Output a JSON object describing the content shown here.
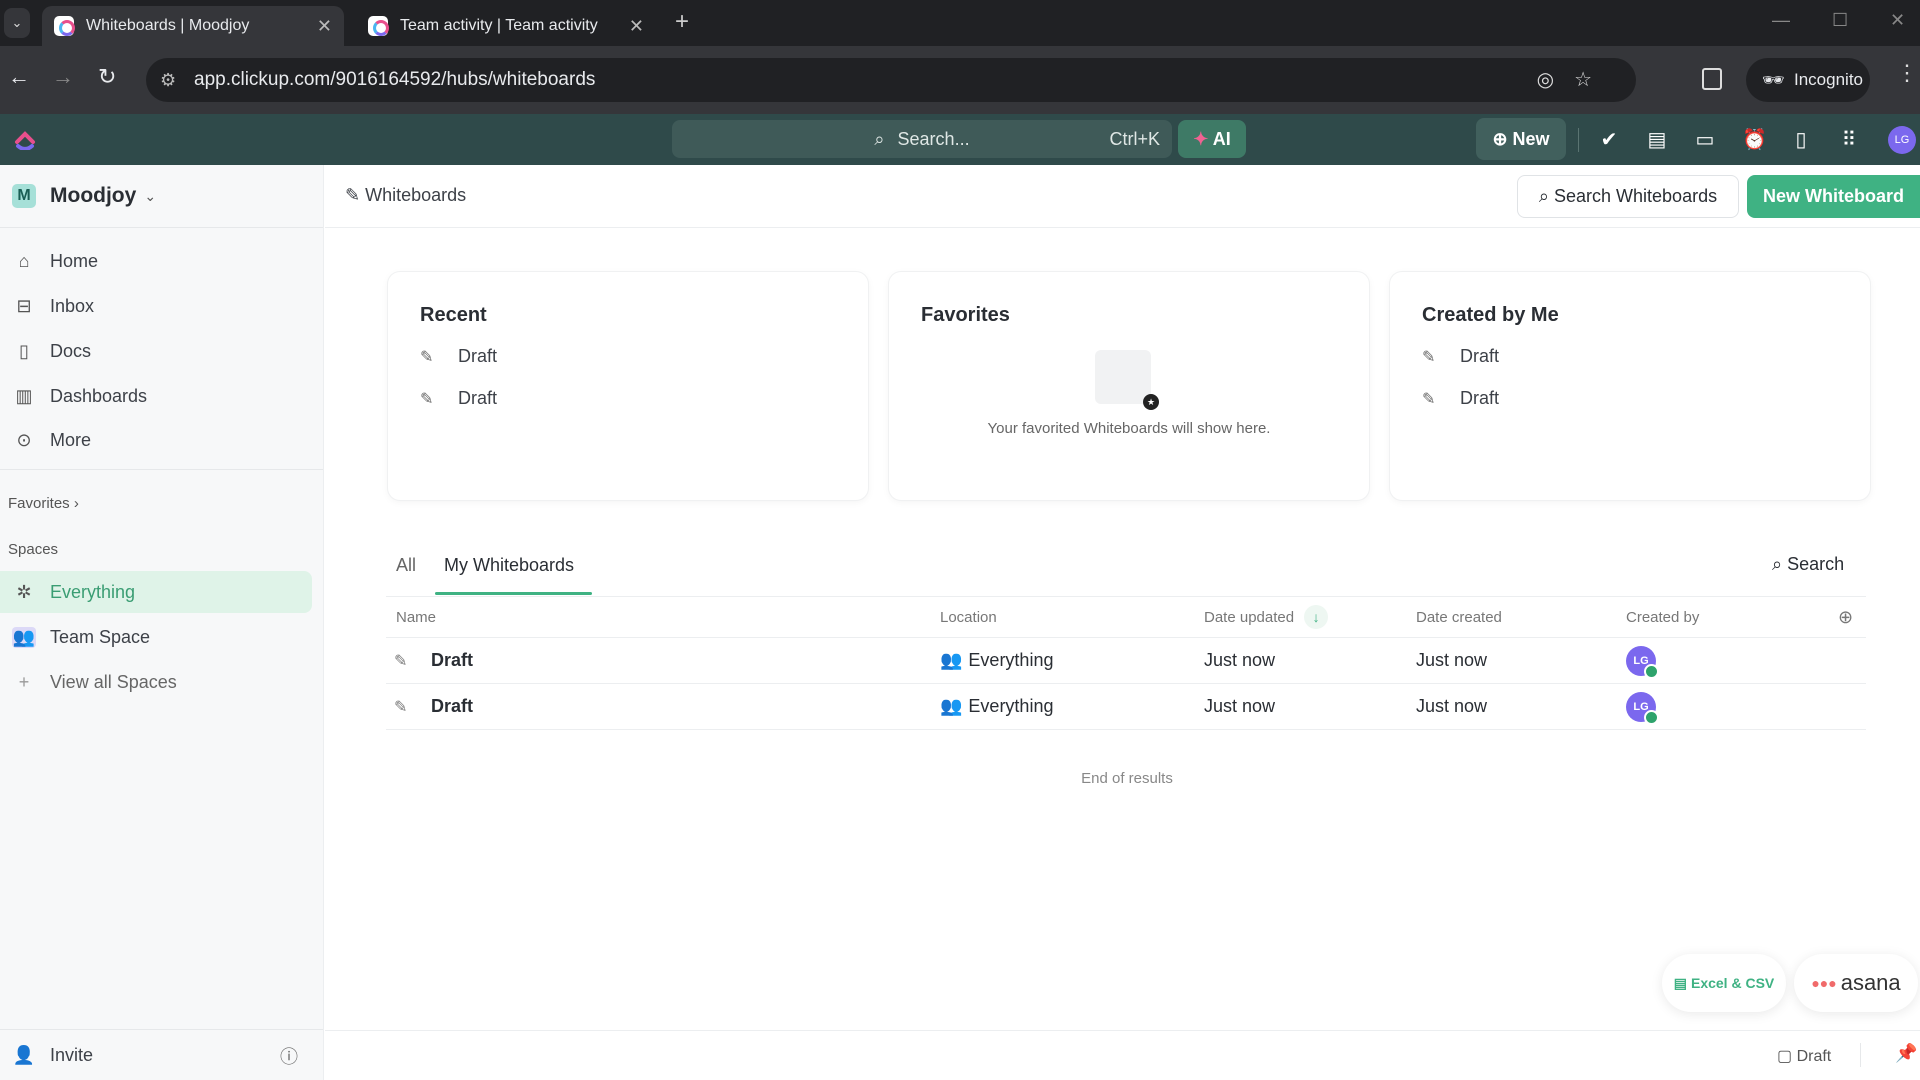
{
  "browser": {
    "tabs": [
      {
        "title": "Whiteboards | Moodjoy",
        "active": true
      },
      {
        "title": "Team activity | Team activity",
        "active": false
      }
    ],
    "url": "app.clickup.com/9016164592/hubs/whiteboards",
    "incognito_label": "Incognito"
  },
  "topbar": {
    "search_placeholder": "Search...",
    "search_shortcut": "Ctrl+K",
    "ai_label": "AI",
    "new_label": "New",
    "avatar_initials": "LG"
  },
  "sidebar": {
    "workspace_initial": "M",
    "workspace_name": "Moodjoy",
    "items": [
      {
        "label": "Home",
        "icon": "home-icon"
      },
      {
        "label": "Inbox",
        "icon": "inbox-icon"
      },
      {
        "label": "Docs",
        "icon": "docs-icon"
      },
      {
        "label": "Dashboards",
        "icon": "dashboards-icon"
      },
      {
        "label": "More",
        "icon": "more-icon"
      }
    ],
    "favorites_label": "Favorites",
    "spaces_label": "Spaces",
    "spaces": [
      {
        "label": "Everything",
        "active": true
      },
      {
        "label": "Team Space",
        "active": false
      },
      {
        "label": "View all Spaces",
        "active": false
      }
    ],
    "invite_label": "Invite"
  },
  "header": {
    "breadcrumb": "Whiteboards",
    "search_button": "Search Whiteboards",
    "new_button": "New Whiteboard"
  },
  "cards": {
    "recent": {
      "title": "Recent",
      "items": [
        "Draft",
        "Draft"
      ]
    },
    "favorites": {
      "title": "Favorites",
      "empty_text": "Your favorited Whiteboards will show here."
    },
    "created_by_me": {
      "title": "Created by Me",
      "items": [
        "Draft",
        "Draft"
      ]
    }
  },
  "list": {
    "tabs": [
      {
        "label": "All",
        "active": false
      },
      {
        "label": "My Whiteboards",
        "active": true
      }
    ],
    "search_label": "Search",
    "columns": [
      "Name",
      "Location",
      "Date updated",
      "Date created",
      "Created by"
    ],
    "rows": [
      {
        "name": "Draft",
        "location": "Everything",
        "date_updated": "Just now",
        "date_created": "Just now",
        "created_by": "LG"
      },
      {
        "name": "Draft",
        "location": "Everything",
        "date_updated": "Just now",
        "date_created": "Just now",
        "created_by": "LG"
      }
    ],
    "end_text": "End of results"
  },
  "integrations": {
    "excel_label": "Excel & CSV",
    "asana_label": "asana"
  },
  "footer": {
    "draft_label": "Draft"
  },
  "colors": {
    "accent": "#3fb283",
    "topbar": "#2f4a4a",
    "avatar": "#7b68ee"
  }
}
